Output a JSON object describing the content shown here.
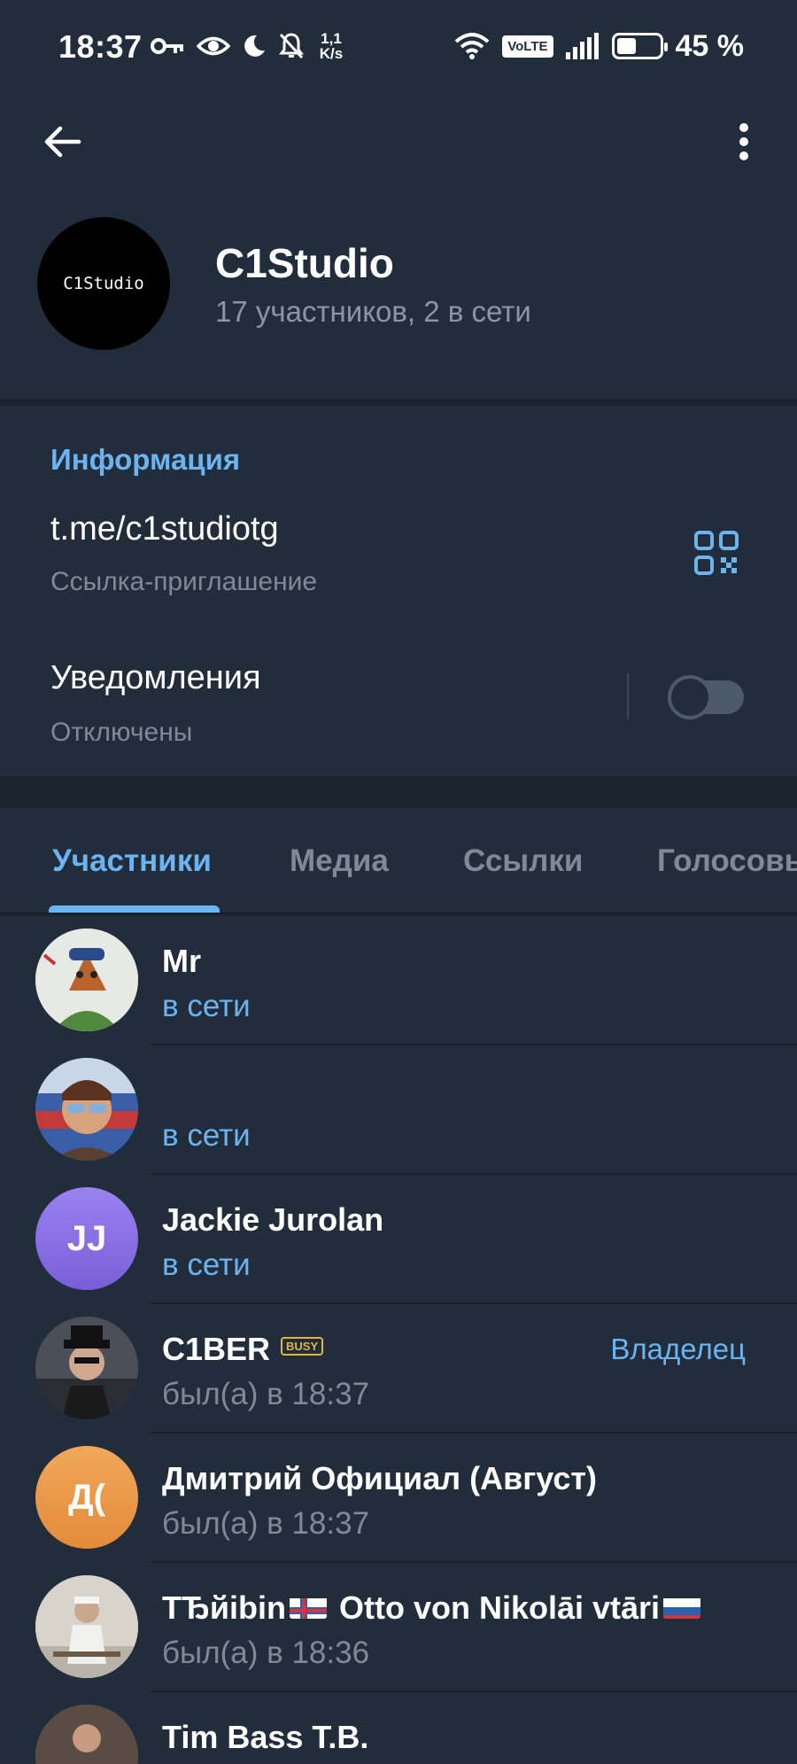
{
  "status_bar": {
    "time": "18:37",
    "speed_top": "1,1",
    "speed_bottom": "K/s",
    "volte": "VoLTE",
    "battery_text": "45 %",
    "battery_level": 0.45
  },
  "header": {
    "avatar_text": "C1Studio",
    "name": "C1Studio",
    "subtitle": "17 участников, 2 в сети"
  },
  "info": {
    "title": "Информация",
    "link": "t.me/c1studiotg",
    "link_sub": "Ссылка-приглашение",
    "notifications": "Уведомления",
    "notifications_sub": "Отключены",
    "notifications_on": false
  },
  "tabs": [
    "Участники",
    "Медиа",
    "Ссылки",
    "Голосовые"
  ],
  "members": [
    {
      "name": "Mr",
      "status": "в сети",
      "online": true,
      "initials": "",
      "color": "#3e5a3a"
    },
    {
      "name": "",
      "status": "в сети",
      "online": true,
      "initials": "",
      "color": "#5a4a3a"
    },
    {
      "name": "Jackie Jurolan",
      "status": "в сети",
      "online": true,
      "initials": "JJ",
      "color": "#8b6fe0"
    },
    {
      "name": "C1BER",
      "status": "был(а) в 18:37",
      "online": false,
      "initials": "",
      "color": "#3a3f48",
      "badge": "BUSY",
      "role": "Владелец"
    },
    {
      "name": "Дмитрий Официал (Август)",
      "status": "был(а) в 18:37",
      "online": false,
      "initials": "Д(",
      "color": "#e8964a"
    },
    {
      "name_part1": "TЂйibin",
      "name_part2": " Otto von Nikolāi vtāri",
      "status": "был(а) в 18:36",
      "online": false,
      "initials": "",
      "color": "#d8d4cc"
    },
    {
      "name": "Tim Bass T.B.",
      "status": "",
      "online": false,
      "initials": "",
      "color": "#6a5a50"
    }
  ]
}
